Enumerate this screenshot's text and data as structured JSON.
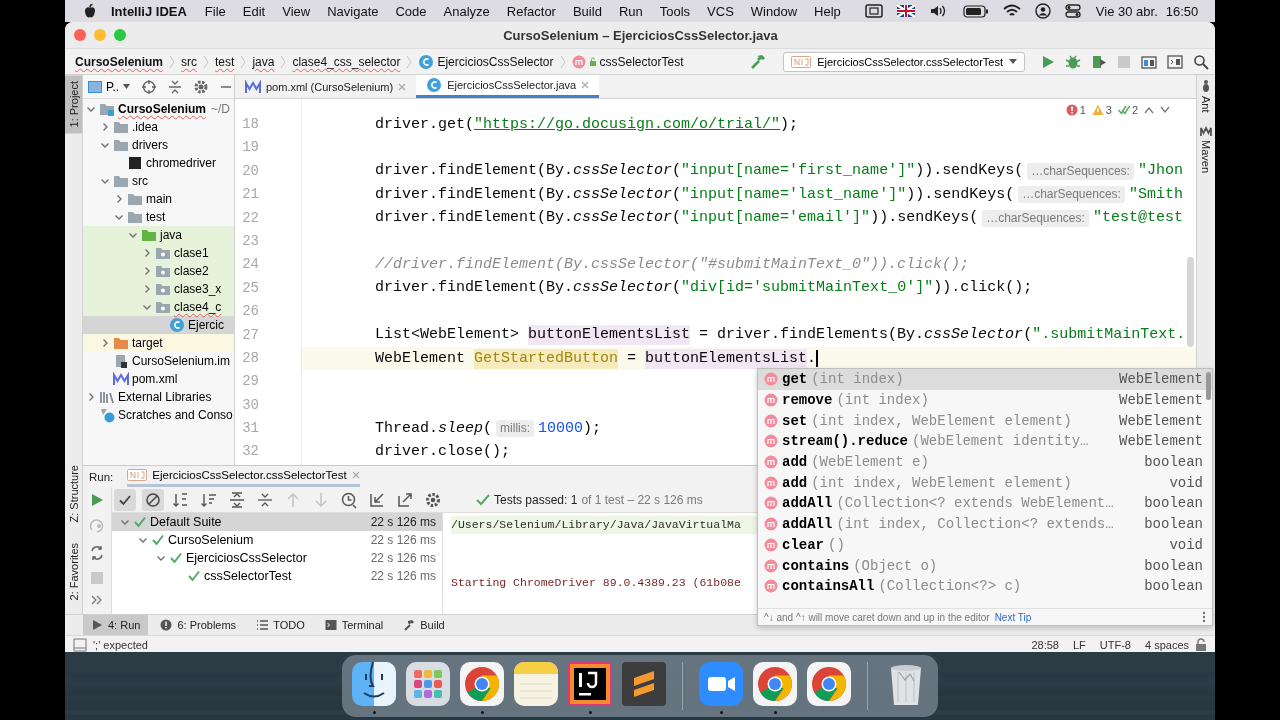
{
  "menubar": {
    "app": "IntelliJ IDEA",
    "menus": [
      "File",
      "Edit",
      "View",
      "Navigate",
      "Code",
      "Analyze",
      "Refactor",
      "Build",
      "Run",
      "Tools",
      "VCS",
      "Window",
      "Help"
    ],
    "date": "Vie 30 abr.",
    "time": "16:50"
  },
  "window": {
    "title": "CursoSelenium – EjerciciosCssSelector.java"
  },
  "navbar": {
    "crumbs": [
      {
        "label": "CursoSelenium",
        "kind": "project"
      },
      {
        "label": "src",
        "kind": "folder"
      },
      {
        "label": "test",
        "kind": "folder"
      },
      {
        "label": "java",
        "kind": "folder"
      },
      {
        "label": "clase4_css_selector",
        "kind": "folder"
      },
      {
        "label": "EjerciciosCssSelector",
        "kind": "class"
      },
      {
        "label": "cssSelectorTest",
        "kind": "method"
      }
    ],
    "run_config": "EjerciciosCssSelector.cssSelectorTest"
  },
  "left_strip": [
    {
      "label": "1: Project",
      "selected": true
    },
    {
      "label": "Z: Structure",
      "selected": false
    },
    {
      "label": "2: Favorites",
      "selected": false
    }
  ],
  "right_strip": [
    {
      "label": "Ant"
    },
    {
      "label": "Maven"
    }
  ],
  "project": {
    "title": "P..",
    "tree": [
      {
        "label": "CursoSelenium",
        "kind": "module",
        "note": "~/D",
        "expanded": true,
        "selected": false,
        "children": [
          {
            "label": ".idea",
            "kind": "folder",
            "expanded": false,
            "selected": false
          },
          {
            "label": "drivers",
            "kind": "folder",
            "expanded": true,
            "selected": false,
            "children": [
              {
                "label": "chromedriver",
                "kind": "binary",
                "selected": false
              }
            ]
          },
          {
            "label": "src",
            "kind": "folder",
            "expanded": true,
            "selected": false,
            "children": [
              {
                "label": "main",
                "kind": "folder",
                "expanded": false,
                "selected": false
              },
              {
                "label": "test",
                "kind": "folder",
                "expanded": true,
                "selected": false,
                "children": [
                  {
                    "label": "java",
                    "kind": "test-root",
                    "test_source": true,
                    "expanded": true,
                    "selected": false,
                    "children": [
                      {
                        "label": "clase1",
                        "kind": "package",
                        "test_source": true,
                        "expanded": false,
                        "selected": false
                      },
                      {
                        "label": "clase2",
                        "kind": "package",
                        "test_source": true,
                        "expanded": false,
                        "selected": false
                      },
                      {
                        "label": "clase3_x",
                        "kind": "package",
                        "test_source": true,
                        "expanded": false,
                        "selected": false
                      },
                      {
                        "label": "clase4_c",
                        "kind": "package",
                        "test_source": true,
                        "expanded": true,
                        "selected": false,
                        "children": [
                          {
                            "label": "Ejercic",
                            "kind": "class",
                            "selected": true
                          }
                        ]
                      }
                    ]
                  }
                ]
              }
            ]
          },
          {
            "label": "target",
            "kind": "excluded-folder",
            "excluded": true,
            "expanded": false,
            "selected": false
          },
          {
            "label": "CursoSelenium.im",
            "kind": "iml",
            "selected": false
          },
          {
            "label": "pom.xml",
            "kind": "maven",
            "selected": false
          }
        ]
      },
      {
        "label": "External Libraries",
        "kind": "library",
        "expanded": false,
        "selected": false
      },
      {
        "label": "Scratches and Conso",
        "kind": "scratches",
        "selected": false
      }
    ]
  },
  "editor": {
    "tabs": [
      {
        "label": "pom.xml (CursoSelenium)",
        "kind": "maven",
        "selected": false
      },
      {
        "label": "EjerciciosCssSelector.java",
        "kind": "class",
        "selected": true
      }
    ],
    "inspections": [
      {
        "kind": "error",
        "count": "1"
      },
      {
        "kind": "warning",
        "count": "3"
      },
      {
        "kind": "ok",
        "count": "2"
      }
    ],
    "lines": [
      {
        "number": "18",
        "current": false,
        "tokens": [
          {
            "kind": "code",
            "t": "driver.get("
          },
          {
            "kind": "url",
            "t": "\"https://go.docusign.com/o/trial/\""
          },
          {
            "kind": "code",
            "t": ");"
          }
        ]
      },
      {
        "number": "19",
        "current": false
      },
      {
        "number": "20",
        "current": false,
        "tokens": [
          {
            "kind": "code",
            "t": "driver.findElement(By."
          },
          {
            "kind": "static",
            "t": "cssSelector"
          },
          {
            "kind": "code",
            "t": "("
          },
          {
            "kind": "string",
            "t": "\"input[name='first_name']\""
          },
          {
            "kind": "code",
            "t": ")).sendKeys("
          },
          {
            "kind": "hint",
            "t": "…charSequences:"
          },
          {
            "kind": "string",
            "t": "\"Jhon"
          }
        ]
      },
      {
        "number": "21",
        "current": false,
        "tokens": [
          {
            "kind": "code",
            "t": "driver.findElement(By."
          },
          {
            "kind": "static",
            "t": "cssSelector"
          },
          {
            "kind": "code",
            "t": "("
          },
          {
            "kind": "string",
            "t": "\"input[name='last_name']\""
          },
          {
            "kind": "code",
            "t": ")).sendKeys("
          },
          {
            "kind": "hint",
            "t": "…charSequences:"
          },
          {
            "kind": "string",
            "t": "\"Smith"
          }
        ]
      },
      {
        "number": "22",
        "current": false,
        "tokens": [
          {
            "kind": "code",
            "t": "driver.findElement(By."
          },
          {
            "kind": "static",
            "t": "cssSelector"
          },
          {
            "kind": "code",
            "t": "("
          },
          {
            "kind": "string",
            "t": "\"input[name='email']\""
          },
          {
            "kind": "code",
            "t": ")).sendKeys("
          },
          {
            "kind": "hint",
            "t": "…charSequences:"
          },
          {
            "kind": "string",
            "t": "\"test@test"
          }
        ]
      },
      {
        "number": "23",
        "current": false
      },
      {
        "number": "24",
        "current": false,
        "tokens": [
          {
            "kind": "comment",
            "t": "//driver.findElement(By.cssSelector(\"#submitMainText_0\")).click();"
          }
        ]
      },
      {
        "number": "25",
        "current": false,
        "tokens": [
          {
            "kind": "code",
            "t": "driver.findElement(By."
          },
          {
            "kind": "static",
            "t": "cssSelector"
          },
          {
            "kind": "code",
            "t": "("
          },
          {
            "kind": "string",
            "t": "\"div[id='submitMainText_0']\""
          },
          {
            "kind": "code",
            "t": ")).click();"
          }
        ]
      },
      {
        "number": "26",
        "current": false
      },
      {
        "number": "27",
        "current": false,
        "tokens": [
          {
            "kind": "code",
            "t": "List<WebElement> "
          },
          {
            "kind": "ident",
            "t": "buttonElementsList"
          },
          {
            "kind": "code",
            "t": " = driver.findElements(By."
          },
          {
            "kind": "static",
            "t": "cssSelector"
          },
          {
            "kind": "code",
            "t": "("
          },
          {
            "kind": "string",
            "t": "\".submitMainText."
          }
        ]
      },
      {
        "number": "28",
        "current": true,
        "caret": true,
        "tokens": [
          {
            "kind": "code",
            "t": "WebElement "
          },
          {
            "kind": "unused",
            "t": "GetStartedButton"
          },
          {
            "kind": "code",
            "t": " = "
          },
          {
            "kind": "ident",
            "t": "buttonElementsList"
          },
          {
            "kind": "code",
            "t": "."
          }
        ]
      },
      {
        "number": "29",
        "current": false
      },
      {
        "number": "30",
        "current": false
      },
      {
        "number": "31",
        "current": false,
        "tokens": [
          {
            "kind": "code",
            "t": "Thread."
          },
          {
            "kind": "static",
            "t": "sleep"
          },
          {
            "kind": "code",
            "t": "("
          },
          {
            "kind": "hint",
            "t": "millis:"
          },
          {
            "kind": "number",
            "t": "10000"
          },
          {
            "kind": "code",
            "t": ");"
          }
        ]
      },
      {
        "number": "32",
        "current": false,
        "tokens": [
          {
            "kind": "code",
            "t": "driver.close();"
          }
        ]
      }
    ]
  },
  "completion": {
    "items": [
      {
        "name": "get",
        "params": "(int index)",
        "type": "WebElement",
        "selected": true
      },
      {
        "name": "remove",
        "params": "(int index)",
        "type": "WebElement",
        "selected": false
      },
      {
        "name": "set",
        "params": "(int index, WebElement element)",
        "type": "WebElement",
        "selected": false
      },
      {
        "name": "stream().reduce",
        "params": "(WebElement identity…",
        "type": "WebElement",
        "selected": false
      },
      {
        "name": "add",
        "params": "(WebElement e)",
        "type": "boolean",
        "selected": false
      },
      {
        "name": "add",
        "params": "(int index, WebElement element)",
        "type": "void",
        "selected": false
      },
      {
        "name": "addAll",
        "params": "(Collection<? extends WebElement…",
        "type": "boolean",
        "selected": false
      },
      {
        "name": "addAll",
        "params": "(int index, Collection<? extends…",
        "type": "boolean",
        "selected": false
      },
      {
        "name": "clear",
        "params": "()",
        "type": "void",
        "selected": false
      },
      {
        "name": "contains",
        "params": "(Object o)",
        "type": "boolean",
        "selected": false
      },
      {
        "name": "containsAll",
        "params": "(Collection<?> c)",
        "type": "boolean",
        "selected": false
      }
    ],
    "tip": "^↓ and ^↑ will move caret down and up in the editor",
    "tip_link": "Next Tip"
  },
  "run": {
    "label": "Run:",
    "tab": "EjerciciosCssSelector.cssSelectorTest",
    "status": "Tests passed: 1",
    "status_detail": "of 1 test – 22 s 126 ms",
    "tests": [
      {
        "label": "Default Suite",
        "time": "22 s 126 ms",
        "expanded": true,
        "selected": true,
        "children": [
          {
            "label": "CursoSelenium",
            "time": "22 s 126 ms",
            "expanded": true,
            "selected": false,
            "children": [
              {
                "label": "EjerciciosCssSelector",
                "time": "22 s 126 ms",
                "expanded": true,
                "selected": false,
                "children": [
                  {
                    "label": "cssSelectorTest",
                    "time": "22 s 126 ms",
                    "selected": false
                  }
                ]
              }
            ]
          }
        ]
      }
    ],
    "console": [
      {
        "kind": "command",
        "text": "/Users/Selenium/Library/Java/JavaVirtualMa"
      },
      {
        "kind": "stderr",
        "text": "Starting ChromeDriver 89.0.4389.23 (61b08e"
      }
    ]
  },
  "tool_tabs": [
    {
      "label": "4: Run",
      "kind": "run",
      "selected": true
    },
    {
      "label": "6: Problems",
      "kind": "problems",
      "selected": false
    },
    {
      "label": "TODO",
      "kind": "todo",
      "selected": false
    },
    {
      "label": "Terminal",
      "kind": "terminal",
      "selected": false
    },
    {
      "label": "Build",
      "kind": "build",
      "selected": false
    }
  ],
  "status_bar": {
    "message": "';' expected",
    "position": "28:58",
    "line_separator": "LF",
    "encoding": "UTF-8",
    "indent": "4 spaces"
  },
  "dock": [
    {
      "kind": "finder",
      "running": true
    },
    {
      "kind": "launchpad",
      "running": false
    },
    {
      "kind": "chrome",
      "running": true
    },
    {
      "kind": "notes",
      "running": false
    },
    {
      "kind": "intellij",
      "running": true
    },
    {
      "kind": "sublime",
      "running": false
    },
    {
      "kind": "separator"
    },
    {
      "kind": "zoom",
      "running": true
    },
    {
      "kind": "chrome",
      "running": true
    },
    {
      "kind": "chrome",
      "running": false
    },
    {
      "kind": "separator"
    },
    {
      "kind": "trash",
      "running": false
    }
  ]
}
